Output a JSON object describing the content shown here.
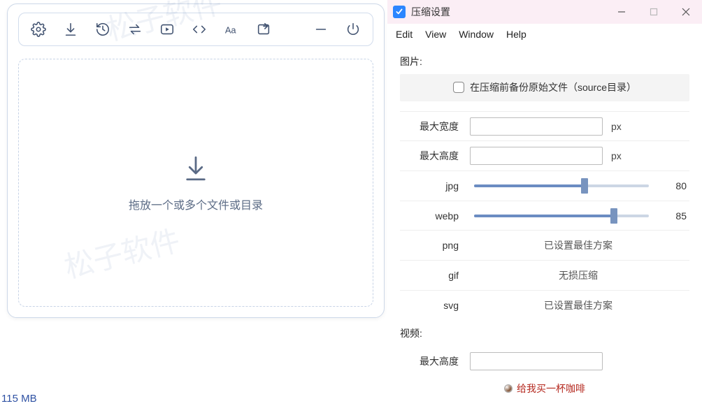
{
  "left": {
    "dropzone_text": "拖放一个或多个文件或目录",
    "status_text": "115 MB",
    "watermark": "松子软件"
  },
  "right": {
    "title": "压缩设置",
    "menu": {
      "edit": "Edit",
      "view": "View",
      "window": "Window",
      "help": "Help"
    },
    "image_section": "图片:",
    "backup_label": "在压缩前备份原始文件（source目录）",
    "max_width_label": "最大宽度",
    "max_width_value": "",
    "max_height_label": "最大高度",
    "max_height_value": "",
    "px_suffix": "px",
    "jpg_label": "jpg",
    "jpg_value": "80",
    "webp_label": "webp",
    "webp_value": "85",
    "png_label": "png",
    "png_note": "已设置最佳方案",
    "gif_label": "gif",
    "gif_note": "无损压缩",
    "svg_label": "svg",
    "svg_note": "已设置最佳方案",
    "video_section": "视频:",
    "video_max_height_label": "最大高度",
    "video_max_height_value": "",
    "donate": "给我买一杯咖啡"
  }
}
